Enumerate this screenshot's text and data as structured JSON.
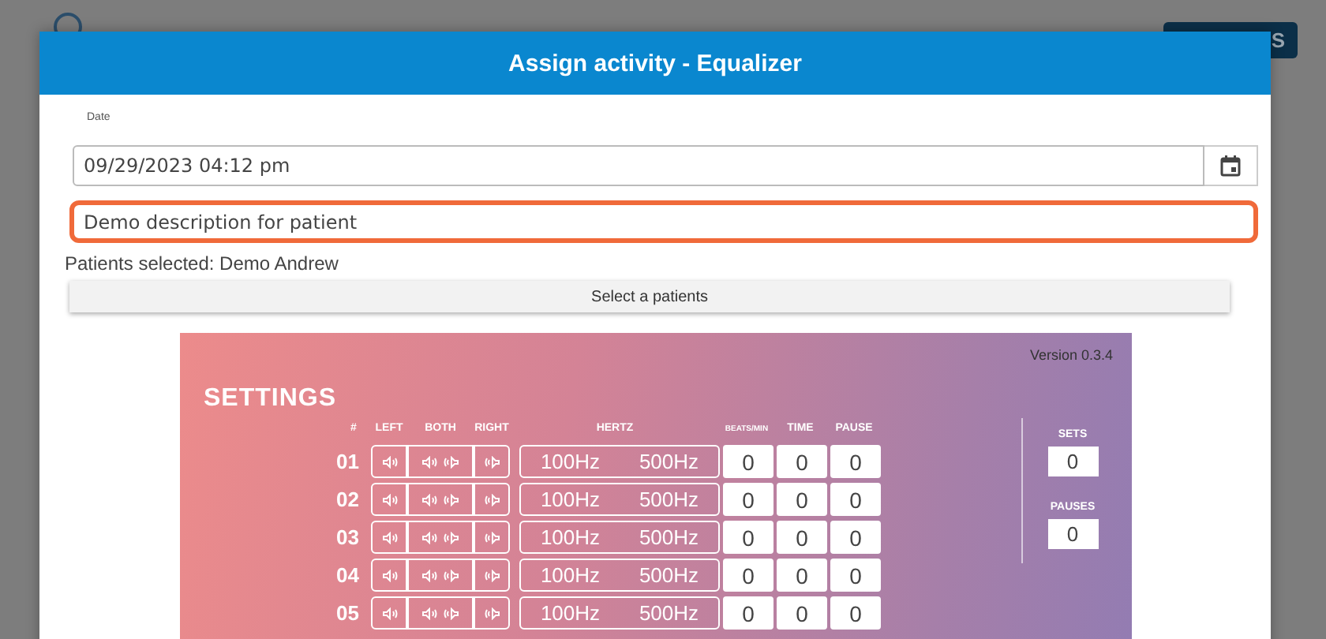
{
  "background": {
    "button_label": "S"
  },
  "dialog": {
    "title": "Assign activity - Equalizer",
    "date": {
      "label": "Date",
      "value": "09/29/2023 04:12 pm"
    },
    "description": {
      "value": "Demo description for patient",
      "focused": true
    },
    "patients_selected": "Patients selected: Demo Andrew",
    "select_button": "Select a patients",
    "equalizer": {
      "version": "Version 0.3.4",
      "title": "SETTINGS",
      "columns": [
        "#",
        "LEFT",
        "BOTH",
        "RIGHT",
        "HERTZ",
        "BEATS/MIN",
        "TIME",
        "PAUSE"
      ],
      "rows": [
        {
          "number": "01",
          "hertz_low": "100Hz",
          "hertz_high": "500Hz",
          "beats_per_min": "0",
          "time": "0",
          "pause": "0"
        },
        {
          "number": "02",
          "hertz_low": "100Hz",
          "hertz_high": "500Hz",
          "beats_per_min": "0",
          "time": "0",
          "pause": "0"
        },
        {
          "number": "03",
          "hertz_low": "100Hz",
          "hertz_high": "500Hz",
          "beats_per_min": "0",
          "time": "0",
          "pause": "0"
        },
        {
          "number": "04",
          "hertz_low": "100Hz",
          "hertz_high": "500Hz",
          "beats_per_min": "0",
          "time": "0",
          "pause": "0"
        },
        {
          "number": "05",
          "hertz_low": "100Hz",
          "hertz_high": "500Hz",
          "beats_per_min": "0",
          "time": "0",
          "pause": "0"
        }
      ],
      "sets": {
        "label": "SETS",
        "value": "0"
      },
      "pauses": {
        "label": "PAUSES",
        "value": "0"
      }
    }
  }
}
